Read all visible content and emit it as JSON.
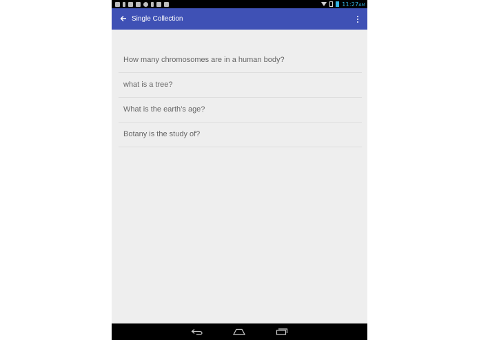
{
  "status_bar": {
    "time": "11:27",
    "ampm": "AM",
    "notification_icons": [
      "wrench-icon",
      "usb-icon",
      "image-icon",
      "mail-icon",
      "chat-icon",
      "usb-icon",
      "copy-icon",
      "copy-icon"
    ],
    "wifi_icon": "wifi-icon",
    "battery_icons": [
      "battery-icon",
      "battery-charging-icon"
    ],
    "accent_color": "#33b5e5"
  },
  "app_bar": {
    "title": "Single Collection",
    "back_icon": "arrow-back-icon",
    "menu_icon": "more-vert-icon",
    "color": "#3f51b5"
  },
  "questions": [
    {
      "text": "How many chromosomes are in a human body?"
    },
    {
      "text": "what is a tree?"
    },
    {
      "text": "What is the earth’s age?"
    },
    {
      "text": "Botany is the study of?"
    }
  ],
  "nav_bar": {
    "back_icon": "nav-back-icon",
    "home_icon": "nav-home-icon",
    "recents_icon": "nav-recents-icon"
  }
}
